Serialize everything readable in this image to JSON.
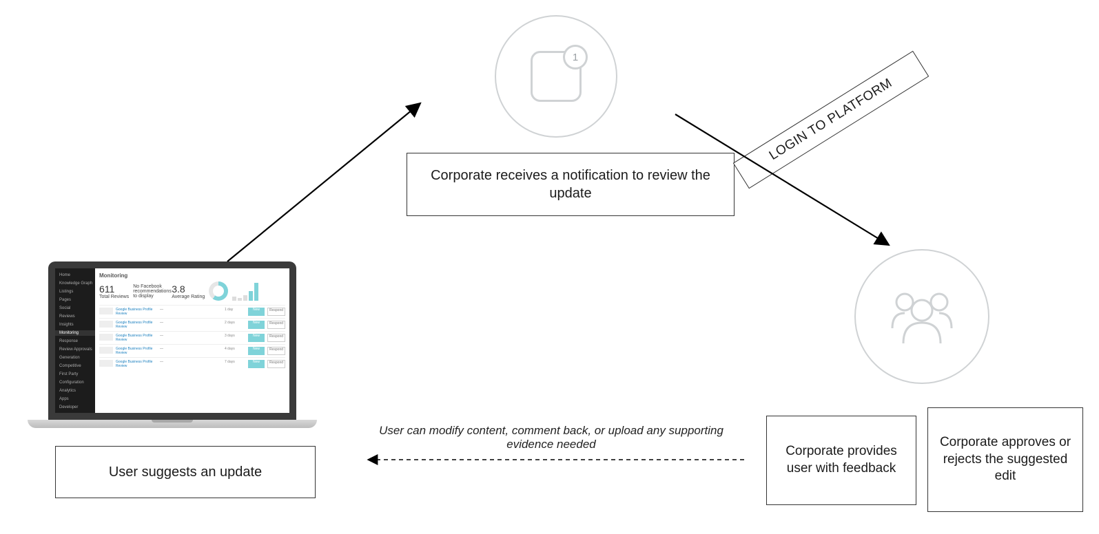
{
  "step1": {
    "label": "User suggests an update"
  },
  "step2": {
    "label": "Corporate receives a notification to review the update",
    "badge": "1"
  },
  "step3": {
    "label": "LOGIN TO PLATFORM"
  },
  "step4a": {
    "label": "Corporate provides user with feedback"
  },
  "step4b": {
    "label": "Corporate approves or rejects the suggested edit"
  },
  "feedback_note": "User can modify content, comment back, or upload any supporting evidence needed",
  "laptop": {
    "title": "Monitoring",
    "total_reviews": "611",
    "total_reviews_label": "Total Reviews",
    "fb_note": "No Facebook recommendations to display",
    "avg_rating": "3.8",
    "avg_rating_label": "Average Rating",
    "sidebar": [
      "Home",
      "Knowledge Graph",
      "Listings",
      "Pages",
      "Social",
      "Reviews",
      "Insights",
      "Monitoring",
      "Response",
      "Review Approvals",
      "Generation",
      "Competitive",
      "First Party",
      "Configuration",
      "Analytics",
      "Apps",
      "Developer"
    ],
    "active_item": "Monitoring",
    "row_title": "Google Business Profile Review",
    "respond": "Respond"
  }
}
